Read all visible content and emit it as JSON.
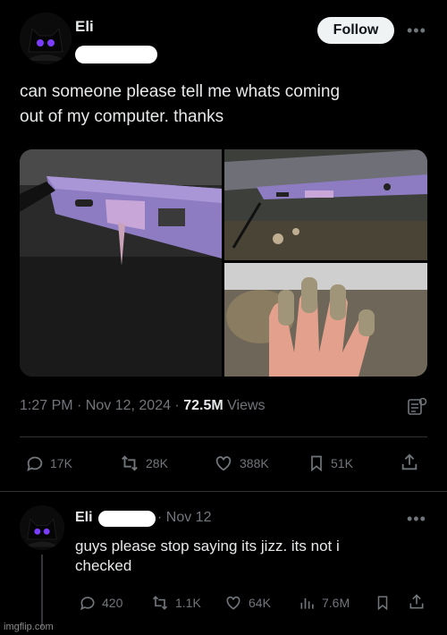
{
  "post": {
    "author": "Eli",
    "follow_label": "Follow",
    "more": "•••",
    "text_line1": "can someone please tell me whats coming",
    "text_line2": "out of my computer. thanks",
    "timestamp": "1:27 PM · Nov 12, 2024 ·",
    "views_count": "72.5M",
    "views_label": "Views",
    "stats": {
      "replies": "17K",
      "reposts": "28K",
      "likes": "388K",
      "bookmarks": "51K"
    }
  },
  "reply": {
    "author": "Eli",
    "date": "· Nov 12",
    "text_line1": "guys please stop saying its jizz. its not i",
    "text_line2": "checked",
    "more": "•••",
    "stats": {
      "replies": "420",
      "reposts": "1.1K",
      "likes": "64K",
      "views": "7.6M"
    }
  },
  "watermark": "imgflip.com",
  "colors": {
    "background": "#000000",
    "text": "#e7e9ea",
    "muted": "#71767b",
    "divider": "#2f3336",
    "follow_bg": "#eff3f4"
  },
  "icons": [
    "reply-icon",
    "repost-icon",
    "like-icon",
    "bookmark-icon",
    "share-icon",
    "analytics-icon",
    "grok-icon",
    "more-icon"
  ]
}
